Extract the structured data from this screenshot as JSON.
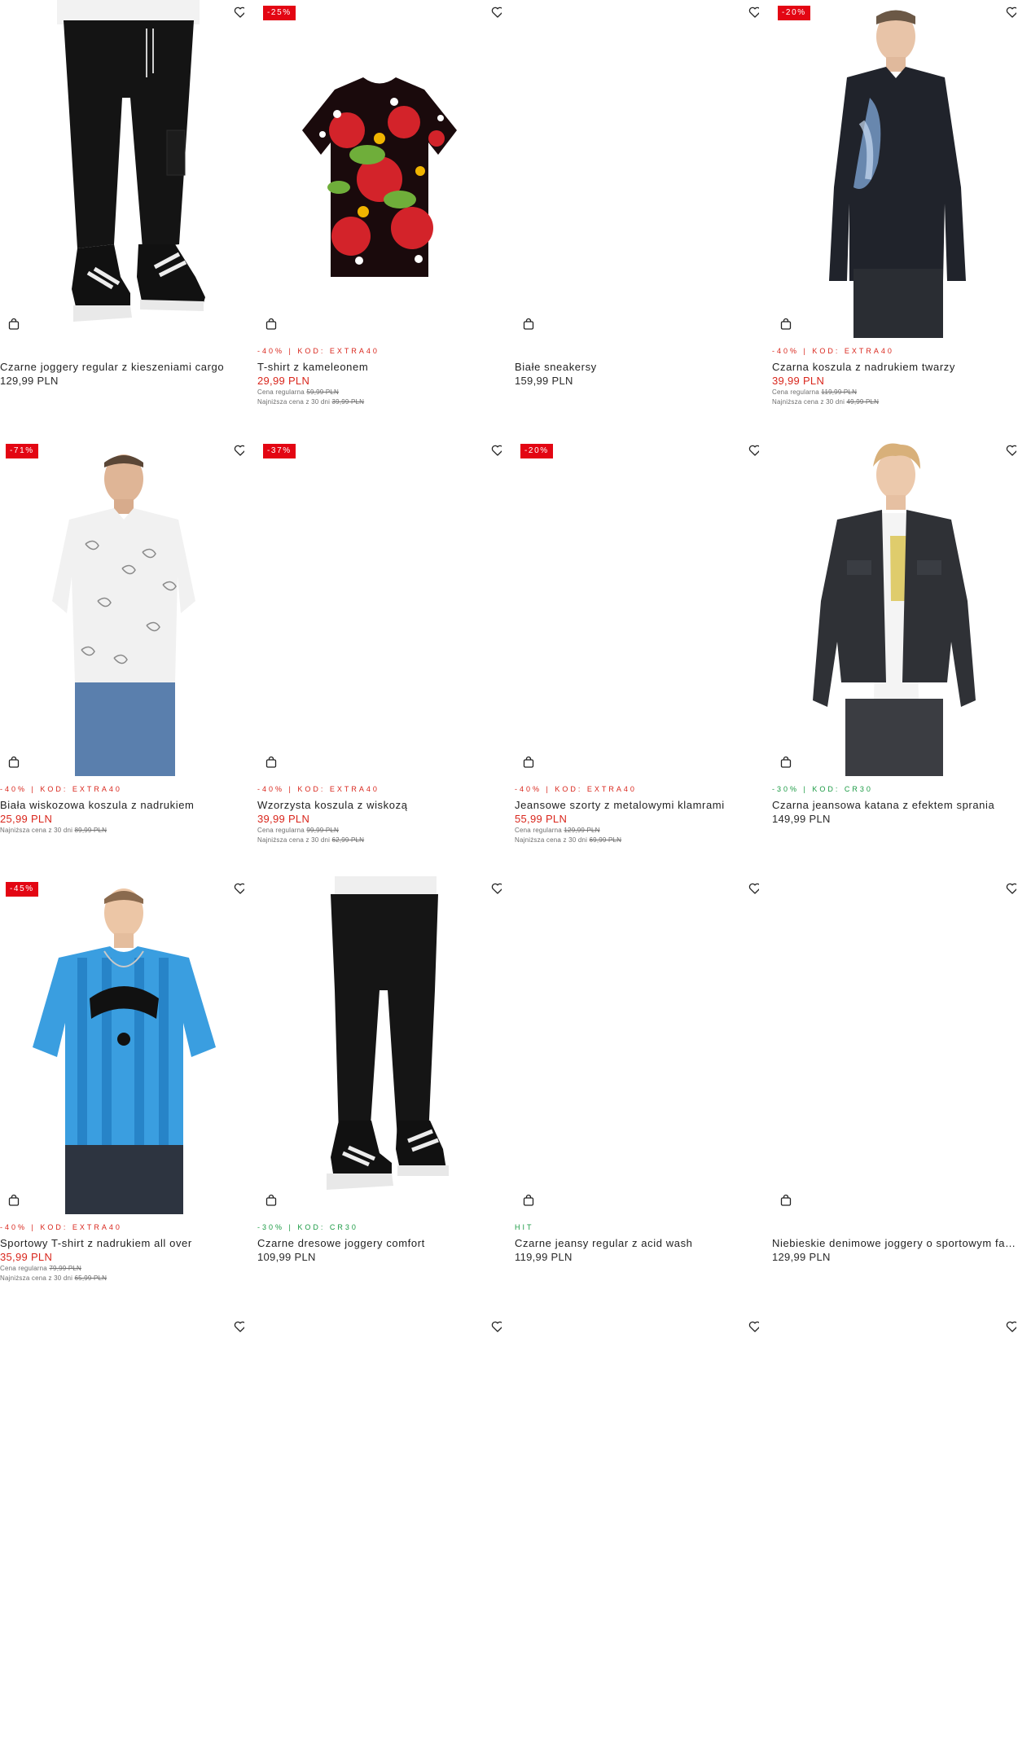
{
  "labels": {
    "regular_price": "Cena regularna",
    "lowest_price": "Najniższa cena z 30 dni"
  },
  "products": [
    {
      "name": "Czarne joggery regular z kieszeniami cargo",
      "price": "129,99 PLN",
      "badge": "",
      "promo": "",
      "promo_color": "",
      "regular_price": "",
      "lowest_price": "",
      "image": "black-cargo-joggers"
    },
    {
      "name": "T-shirt z kameleonem",
      "price": "29,99 PLN",
      "badge": "-25%",
      "promo": "-40% | KOD: EXTRA40",
      "promo_color": "red",
      "regular_price": "59,99 PLN",
      "lowest_price": "39,99 PLN",
      "image": "chameleon-tshirt"
    },
    {
      "name": "Białe sneakersy",
      "price": "159,99 PLN",
      "badge": "",
      "promo": "",
      "promo_color": "",
      "regular_price": "",
      "lowest_price": "",
      "image": ""
    },
    {
      "name": "Czarna koszula z nadrukiem twarzy",
      "price": "39,99 PLN",
      "badge": "-20%",
      "promo": "-40% | KOD: EXTRA40",
      "promo_color": "red",
      "regular_price": "119,99 PLN",
      "lowest_price": "49,99 PLN",
      "image": "black-shirt-model"
    },
    {
      "name": "Biała wiskozowa koszula z nadrukiem",
      "price": "25,99 PLN",
      "badge": "-71%",
      "promo": "-40% | KOD: EXTRA40",
      "promo_color": "red",
      "regular_price": "",
      "lowest_price": "89,99 PLN",
      "image": "white-paisley-shirt-model"
    },
    {
      "name": "Wzorzysta koszula z wiskozą",
      "price": "39,99 PLN",
      "badge": "-37%",
      "promo": "-40% | KOD: EXTRA40",
      "promo_color": "red",
      "regular_price": "99,99 PLN",
      "lowest_price": "62,99 PLN",
      "image": ""
    },
    {
      "name": "Jeansowe szorty z metalowymi klamrami",
      "price": "55,99 PLN",
      "badge": "-20%",
      "promo": "-40% | KOD: EXTRA40",
      "promo_color": "red",
      "regular_price": "129,99 PLN",
      "lowest_price": "69,99 PLN",
      "image": ""
    },
    {
      "name": "Czarna jeansowa katana z efektem sprania",
      "price": "149,99 PLN",
      "badge": "",
      "promo": "-30% | KOD: CR30",
      "promo_color": "green",
      "regular_price": "",
      "lowest_price": "",
      "image": "denim-jacket-model"
    },
    {
      "name": "Sportowy T-shirt z nadrukiem all over",
      "price": "35,99 PLN",
      "badge": "-45%",
      "promo": "-40% | KOD: EXTRA40",
      "promo_color": "red",
      "regular_price": "79,99 PLN",
      "lowest_price": "65,99 PLN",
      "image": "blue-jersey-model"
    },
    {
      "name": "Czarne dresowe joggery comfort",
      "price": "109,99 PLN",
      "badge": "",
      "promo": "-30% | KOD: CR30",
      "promo_color": "green",
      "regular_price": "",
      "lowest_price": "",
      "image": "black-sweatpants"
    },
    {
      "name": "Czarne jeansy regular z acid wash",
      "price": "119,99 PLN",
      "badge": "",
      "promo": "HIT",
      "promo_color": "green",
      "regular_price": "",
      "lowest_price": "",
      "image": ""
    },
    {
      "name": "Niebieskie denimowe joggery o sportowym fas...",
      "price": "129,99 PLN",
      "badge": "",
      "promo": "",
      "promo_color": "",
      "regular_price": "",
      "lowest_price": "",
      "image": ""
    },
    {
      "name": "",
      "price": "",
      "badge": "",
      "promo": "",
      "promo_color": "",
      "regular_price": "",
      "lowest_price": "",
      "image": ""
    },
    {
      "name": "",
      "price": "",
      "badge": "",
      "promo": "",
      "promo_color": "",
      "regular_price": "",
      "lowest_price": "",
      "image": ""
    },
    {
      "name": "",
      "price": "",
      "badge": "",
      "promo": "",
      "promo_color": "",
      "regular_price": "",
      "lowest_price": "",
      "image": ""
    },
    {
      "name": "",
      "price": "",
      "badge": "",
      "promo": "",
      "promo_color": "",
      "regular_price": "",
      "lowest_price": "",
      "image": ""
    }
  ],
  "icons": {
    "wishlist": "heart-icon",
    "add_to_cart": "shopping-bag-icon"
  }
}
